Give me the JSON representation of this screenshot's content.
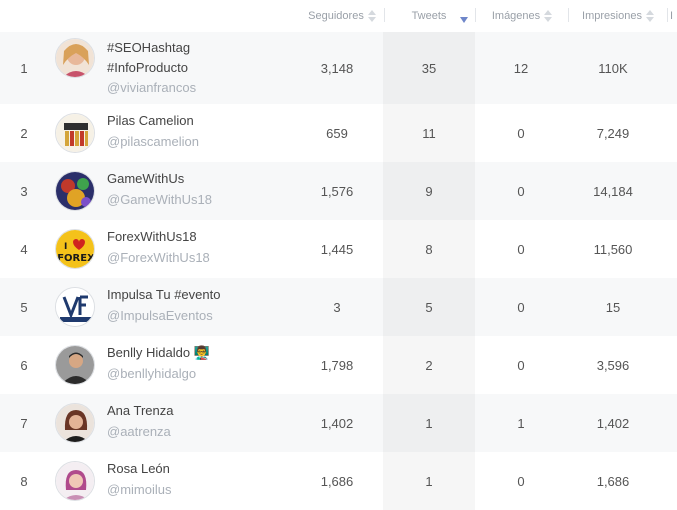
{
  "columns": {
    "followers": "Seguidores",
    "tweets": "Tweets",
    "images": "Imágenes",
    "impressions": "Impresiones",
    "cut": "I"
  },
  "rows": [
    {
      "rank": "1",
      "name_line1": "#SEOHashtag",
      "name_line2": "#InfoProducto",
      "handle": "@vivianfrancos",
      "followers": "3,148",
      "tweets": "35",
      "images": "12",
      "impressions": "110K",
      "avatar_color": "#e8b89a"
    },
    {
      "rank": "2",
      "name_line1": "Pilas Camelion",
      "handle": "@pilascamelion",
      "followers": "659",
      "tweets": "11",
      "images": "0",
      "impressions": "7,249",
      "avatar_color": "#c9a24a"
    },
    {
      "rank": "3",
      "name_line1": "GameWithUs",
      "handle": "@GameWithUs18",
      "followers": "1,576",
      "tweets": "9",
      "images": "0",
      "impressions": "14,184",
      "avatar_color": "#3b4a8f"
    },
    {
      "rank": "4",
      "name_line1": "ForexWithUs18",
      "handle": "@ForexWithUs18",
      "followers": "1,445",
      "tweets": "8",
      "images": "0",
      "impressions": "11,560",
      "avatar_color": "#f4c21a"
    },
    {
      "rank": "5",
      "name_line1": "Impulsa Tu #evento",
      "handle": "@ImpulsaEventos",
      "followers": "3",
      "tweets": "5",
      "images": "0",
      "impressions": "15",
      "avatar_color": "#ffffff"
    },
    {
      "rank": "6",
      "name_line1": "Benlly Hidaldo",
      "emoji": "👨‍🏫",
      "handle": "@benllyhidalgo",
      "followers": "1,798",
      "tweets": "2",
      "images": "0",
      "impressions": "3,596",
      "avatar_color": "#6b6b6b"
    },
    {
      "rank": "7",
      "name_line1": "Ana Trenza",
      "handle": "@aatrenza",
      "followers": "1,402",
      "tweets": "1",
      "images": "1",
      "impressions": "1,402",
      "avatar_color": "#8a4a35"
    },
    {
      "rank": "8",
      "name_line1": "Rosa León",
      "handle": "@mimoilus",
      "followers": "1,686",
      "tweets": "1",
      "images": "0",
      "impressions": "1,686",
      "avatar_color": "#c98fb5"
    }
  ]
}
